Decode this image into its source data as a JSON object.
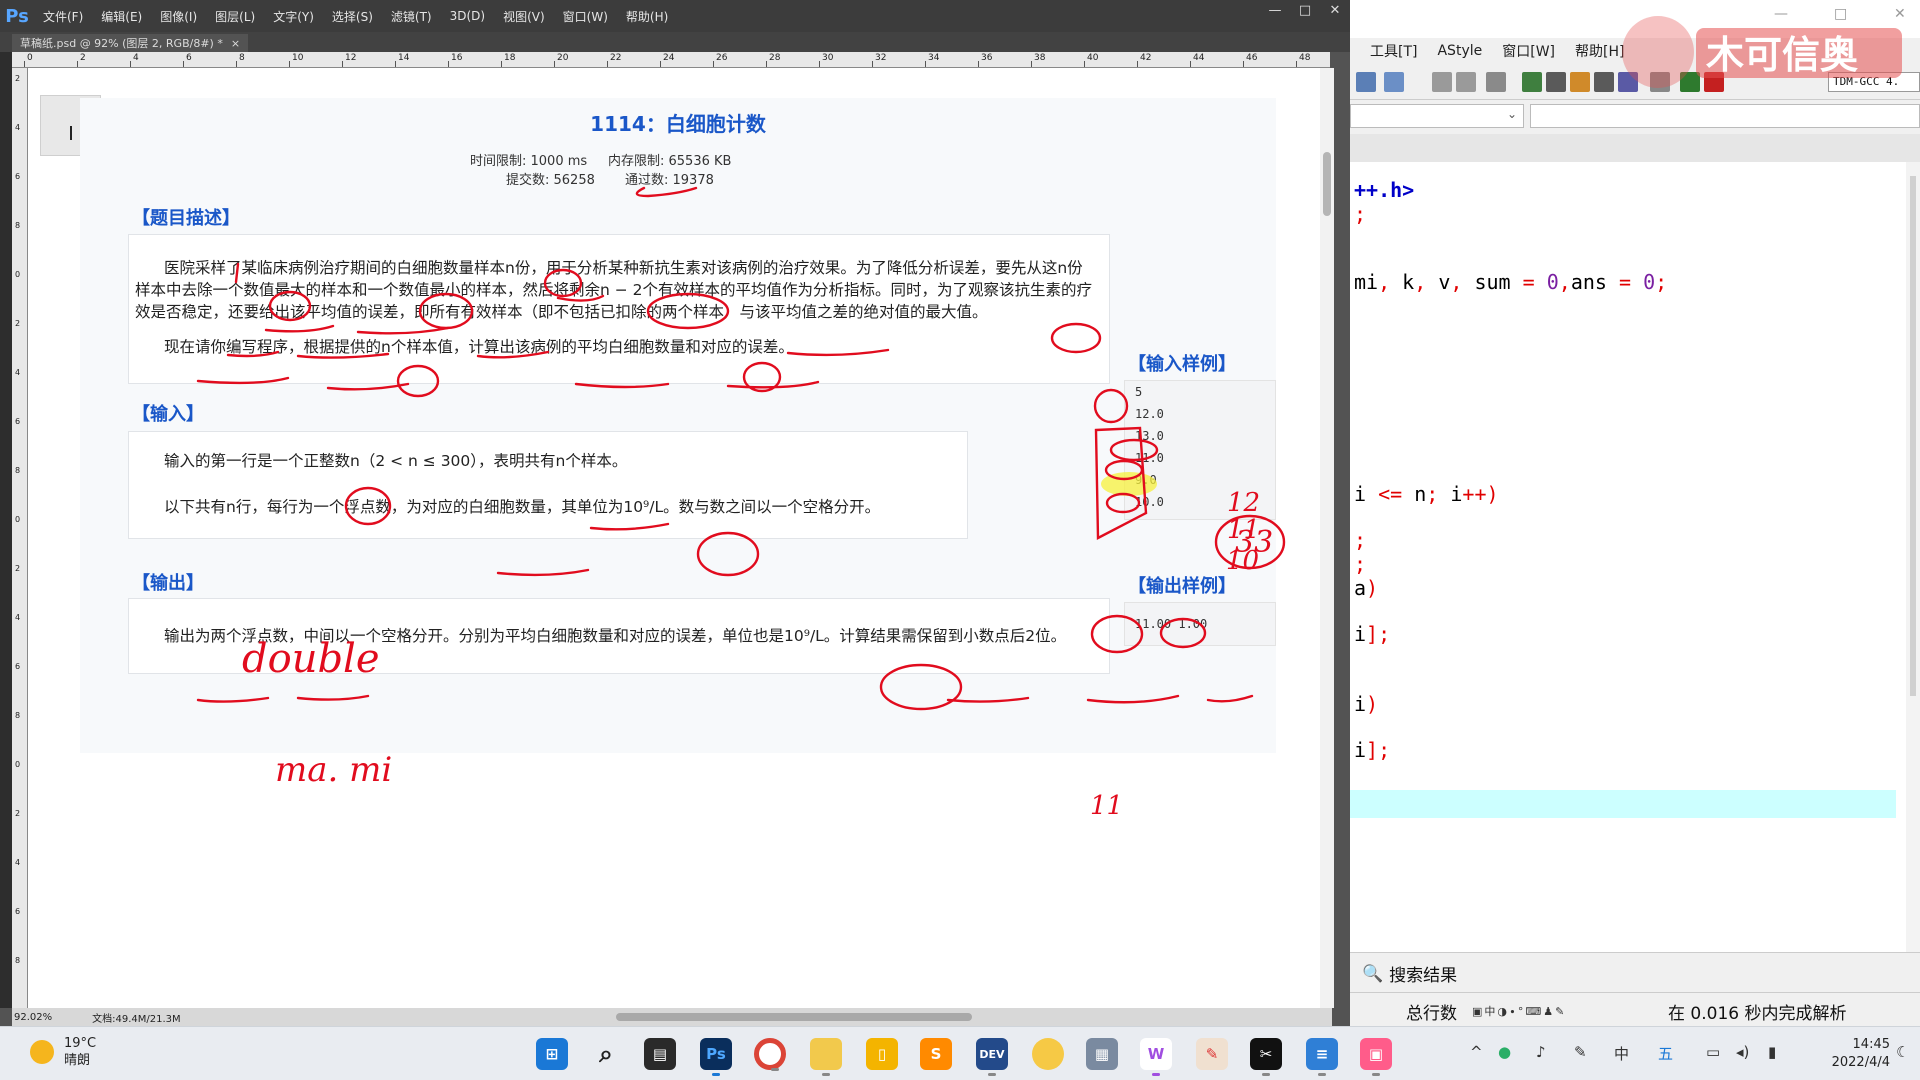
{
  "photoshop": {
    "menus": [
      "文件(F)",
      "编辑(E)",
      "图像(I)",
      "图层(L)",
      "文字(Y)",
      "选择(S)",
      "滤镜(T)",
      "3D(D)",
      "视图(V)",
      "窗口(W)",
      "帮助(H)"
    ],
    "logo": "Ps",
    "doc_tab": "草稿纸.psd @ 92% (图层 2, RGB/8#) *",
    "doc_tab_close": "×",
    "win_min": "—",
    "win_max": "□",
    "win_close": "✕",
    "ruler_h": [
      "0",
      "2",
      "4",
      "6",
      "8",
      "10",
      "12",
      "14",
      "16",
      "18",
      "20",
      "22",
      "24",
      "26",
      "28",
      "30",
      "32",
      "34",
      "36",
      "38",
      "40",
      "42",
      "44",
      "46",
      "48"
    ],
    "ruler_v": [
      "2",
      "4",
      "6",
      "8",
      "0",
      "2",
      "4",
      "6",
      "8",
      "0",
      "2",
      "4",
      "6",
      "8",
      "0",
      "2",
      "4",
      "6",
      "8"
    ],
    "status_zoom": "92.02%",
    "status_doc": "文档:49.4M/21.3M"
  },
  "problem": {
    "title": "1114：白细胞计数",
    "time_limit": "时间限制: 1000 ms",
    "memory_limit": "内存限制: 65536 KB",
    "submissions": "提交数: 56258",
    "accepted": "通过数: 19378",
    "desc_head": "【题目描述】",
    "desc_p1_l1": "医院采样了某临床病例治疗期间的白细胞数量样本n份，用于分析某种新抗生素对该病例的治疗效果。为了降低分析误差，要先从这n份",
    "desc_p1_l2": "样本中去除一个数值最大的样本和一个数值最小的样本，然后将剩余n − 2个有效样本的平均值作为分析指标。同时，为了观察该抗生素的疗",
    "desc_p1_l3": "效是否稳定，还要给出该平均值的误差，即所有有效样本（即不包括已扣除的两个样本）与该平均值之差的绝对值的最大值。",
    "desc_p2": "现在请你编写程序，根据提供的n个样本值，计算出该病例的平均白细胞数量和对应的误差。",
    "input_head": "【输入】",
    "input_p1": "输入的第一行是一个正整数n（2 < n ≤ 300），表明共有n个样本。",
    "input_p2": "以下共有n行，每行为一个浮点数，为对应的白细胞数量，其单位为10⁹/L。数与数之间以一个空格分开。",
    "output_head": "【输出】",
    "output_p1": "输出为两个浮点数，中间以一个空格分开。分别为平均白细胞数量和对应的误差，单位也是10⁹/L。计算结果需保留到小数点后2位。",
    "sample_in_head": "【输入样例】",
    "sample_in": [
      "5",
      "12.0",
      "13.0",
      "11.0",
      "9.0",
      "10.0"
    ],
    "sample_out_head": "【输出样例】",
    "sample_out": "11.00 1.00"
  },
  "annotations": {
    "double": "double",
    "ma_mi": "ma.    mi",
    "n12": "12",
    "n11": "11",
    "n10": "10",
    "n33": "33",
    "n11b": "11"
  },
  "devcpp": {
    "menus": [
      "工具[T]",
      "AStyle",
      "窗口[W]",
      "帮助[H]"
    ],
    "compiler": "TDM-GCC 4.",
    "code_lines": [
      {
        "text": "++.h>",
        "cls": "kw-blue"
      },
      {
        "text": ";",
        "cls": "kw-red"
      },
      {
        "text": "mi, k, v, sum = 0,ans = 0;",
        "cls": "mixed"
      },
      {
        "text": "i <= n; i++)",
        "cls": "mixed"
      },
      {
        "text": ";",
        "cls": "kw-red"
      },
      {
        "text": ";",
        "cls": "kw-red"
      },
      {
        "text": "a)",
        "cls": "mixed"
      },
      {
        "text": "i];",
        "cls": "mixed"
      },
      {
        "text": "i)",
        "cls": "mixed"
      },
      {
        "text": "i];",
        "cls": "mixed"
      }
    ],
    "search_results": "搜索结果",
    "total_lines": "总行数",
    "parse_info": "在 0.016 秒内完成解析"
  },
  "watermark": "木可信奥",
  "taskbar": {
    "temp": "19°C",
    "weather": "晴朗",
    "time": "14:45",
    "date": "2022/4/4"
  },
  "colors": {
    "link_blue": "#1a57c8",
    "ink_red": "#e10c1e",
    "highlight_yellow": "#f7f03c",
    "current_line": "#ccffff"
  }
}
